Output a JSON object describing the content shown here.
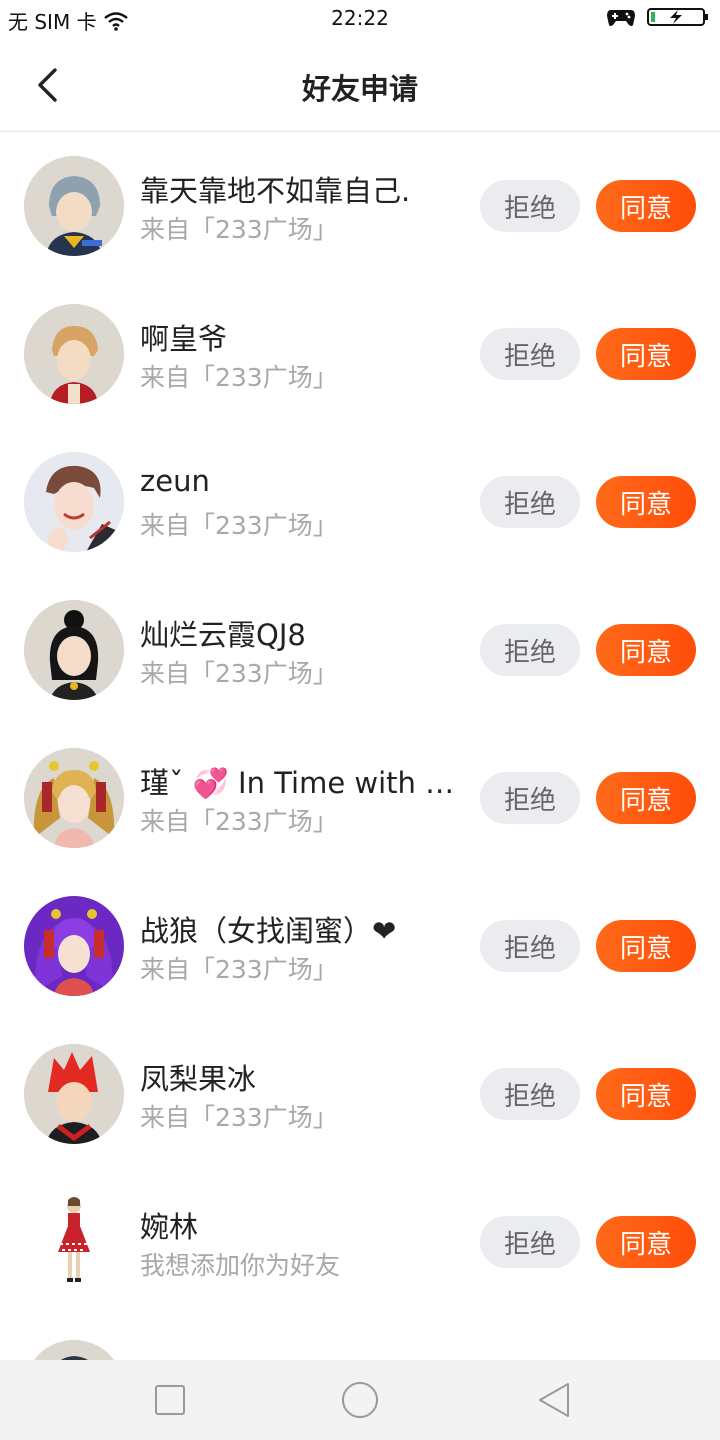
{
  "status_bar": {
    "carrier": "无 SIM 卡",
    "time": "22:22"
  },
  "header": {
    "title": "好友申请"
  },
  "requests": [
    {
      "name": "靠天靠地不如靠自己.",
      "source": "来自「233广场」",
      "reject": "拒绝",
      "accept": "同意"
    },
    {
      "name": "啊皇爷",
      "source": "来自「233广场」",
      "reject": "拒绝",
      "accept": "同意"
    },
    {
      "name": "zeun",
      "source": "来自「233广场」",
      "reject": "拒绝",
      "accept": "同意"
    },
    {
      "name": "灿烂云霞QJ8",
      "source": "来自「233广场」",
      "reject": "拒绝",
      "accept": "同意"
    },
    {
      "name": "瑾ˇ 💞 In Time with You",
      "source": "来自「233广场」",
      "reject": "拒绝",
      "accept": "同意"
    },
    {
      "name": "战狼（女找闺蜜）❤",
      "source": "来自「233广场」",
      "reject": "拒绝",
      "accept": "同意"
    },
    {
      "name": "凤梨果冰",
      "source": "来自「233广场」",
      "reject": "拒绝",
      "accept": "同意"
    },
    {
      "name": "婉林",
      "source": "我想添加你为好友",
      "reject": "拒绝",
      "accept": "同意"
    }
  ],
  "colors": {
    "accept": "#ff5a12",
    "reject_bg": "#ebecf0",
    "secondary_text": "#a8a8a8"
  },
  "icons": {
    "back": "chevron-left-icon",
    "nav_recent": "square-icon",
    "nav_home": "circle-icon",
    "nav_back": "triangle-back-icon"
  }
}
